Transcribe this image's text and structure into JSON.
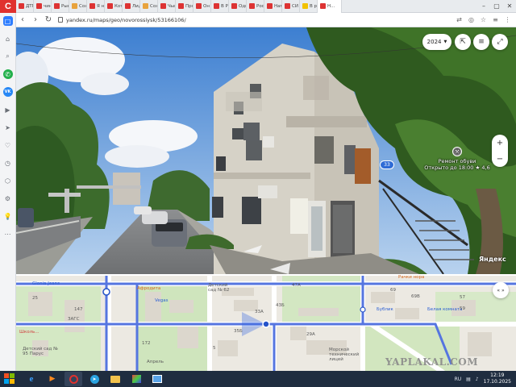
{
  "browser": {
    "tabs": [
      {
        "title": "ДТП",
        "color": "#d33"
      },
      {
        "title": "чинт",
        "color": "#d33"
      },
      {
        "title": "Рыно",
        "color": "#d33"
      },
      {
        "title": "Сохр",
        "color": "#e8a33d"
      },
      {
        "title": "Я не",
        "color": "#d33"
      },
      {
        "title": "Котл",
        "color": "#d33"
      },
      {
        "title": "Лидо",
        "color": "#d33"
      },
      {
        "title": "Сохр",
        "color": "#e8a33d"
      },
      {
        "title": "Чым",
        "color": "#d33"
      },
      {
        "title": "Прос",
        "color": "#d33"
      },
      {
        "title": "Он б",
        "color": "#d33"
      },
      {
        "title": "В Ро",
        "color": "#d33"
      },
      {
        "title": "Один",
        "color": "#d33"
      },
      {
        "title": "Росс",
        "color": "#d33"
      },
      {
        "title": "Нами",
        "color": "#d33"
      },
      {
        "title": "СИ",
        "color": "#d33"
      },
      {
        "title": "В ро",
        "color": "#f2c200"
      },
      {
        "title": "Н...",
        "color": "#d33",
        "active": true
      }
    ],
    "url": "yandex.ru/maps/geo/novorossiysk/53166106/",
    "logo_letter": "C"
  },
  "street_view": {
    "year": "2024",
    "poi": {
      "name": "Ремонт обуви",
      "status": "Открыто до 18:00",
      "rating": "★ 4,6"
    },
    "route_badge": "33",
    "watermark": "Яндекс"
  },
  "map": {
    "labels": {
      "glonia": "Glonia Jeans",
      "afrodita": "Афродита",
      "kindergarten62": "Детский сад № 62",
      "rachkinora": "Рачки нора",
      "zags": "ЗАГС",
      "vegas": "Vegas",
      "bublik": "Бублик",
      "belaya": "Белая комната",
      "kindergarten_parus": "Детский сад № 95 Парус",
      "school_shop": "Школь...",
      "morskoy": "Морской технический лицей",
      "april": "Апрель",
      "n147": "147",
      "n33a": "33А",
      "n43b": "43Б",
      "n47a": "47А",
      "n35b": "35Б",
      "n29a": "29А",
      "n172": "172",
      "n69": "69",
      "n69v": "69В",
      "n57": "57",
      "n59": "59",
      "n25": "25",
      "n5": "5"
    },
    "expand_label": "« »"
  },
  "watermark_site": "YAPLAKAL.COM",
  "taskbar": {
    "lang": "RU",
    "time": "12:19",
    "date": "17.10.2025"
  }
}
